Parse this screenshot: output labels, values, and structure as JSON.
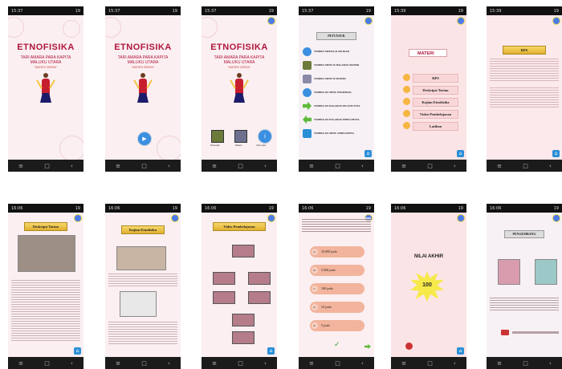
{
  "status": {
    "time_a": "15:37",
    "time_b": "15:39",
    "time_c": "16:06",
    "battery": "19"
  },
  "splash": {
    "title": "ETNOFISIKA",
    "subtitle": "TARI AMARA PARA KAPITA MALUKU UTARA",
    "tagline": "\"MATERI GERAK\""
  },
  "splash3_buttons": [
    "Petunjuk",
    "Materi",
    "Informasi"
  ],
  "menu": {
    "header": "PETUNJUK",
    "items": [
      "TOMBOL MEMULAI APLIKASI",
      "TOMBOL MENUJU HALAMAN MATERI",
      "TOMBOL MENUJU MATERI",
      "TOMBOL KE MENU INFORMASI",
      "TOMBOL KE HALAMAN SELANJUTNYA",
      "TOMBOL KE HALAMAN SEBELUMNYA",
      "TOMBOL KE MENU SEBELUMNYA"
    ]
  },
  "materi": {
    "title": "MATERI",
    "items": [
      "RPS",
      "Deskripsi Tarian",
      "Kajian Etnofisika",
      "Video Pembelajaran",
      "Latihan"
    ]
  },
  "rps": {
    "banner": "RPS"
  },
  "deskripsi": {
    "banner": "Deskripsi Tarian"
  },
  "kajian": {
    "banner": "Kajian Etnofisika"
  },
  "video": {
    "banner": "Video Pembelajaran"
  },
  "quiz": {
    "options": [
      "A.",
      "B.",
      "C.",
      "D.",
      "E."
    ],
    "values": [
      "10.000 joule",
      "5.000 joule",
      "100 joule",
      "10 joule",
      "5 joule"
    ]
  },
  "nilai": {
    "title": "NILAI AKHIR",
    "score": "100"
  },
  "profil": {
    "header": "PENGEMBANG"
  }
}
